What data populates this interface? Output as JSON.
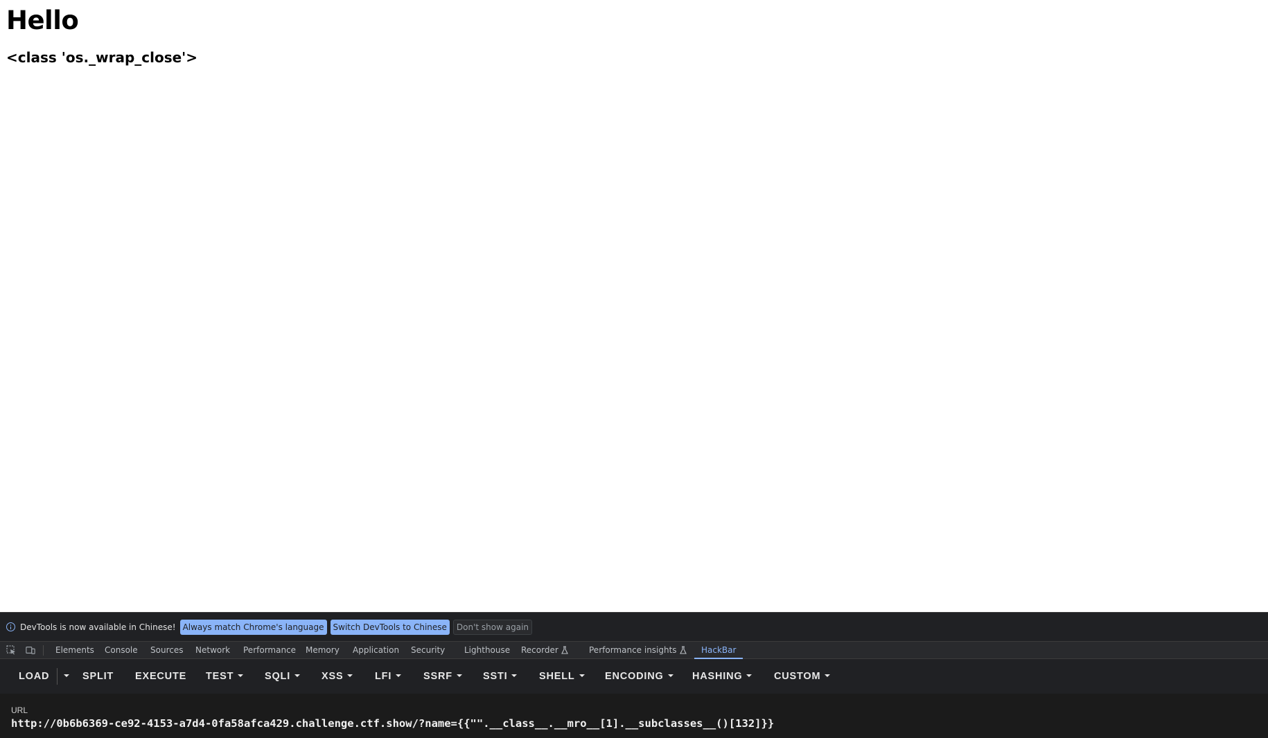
{
  "page": {
    "heading": "Hello",
    "output": "<class 'os._wrap_close'>"
  },
  "devtools": {
    "infobar": {
      "message": "DevTools is now available in Chinese!",
      "buttons": [
        "Always match Chrome's language",
        "Switch DevTools to Chinese",
        "Don't show again"
      ]
    },
    "tabs": [
      {
        "label": "Elements"
      },
      {
        "label": "Console"
      },
      {
        "label": "Sources"
      },
      {
        "label": "Network"
      },
      {
        "label": "Performance"
      },
      {
        "label": "Memory"
      },
      {
        "label": "Application"
      },
      {
        "label": "Security"
      },
      {
        "label": "Lighthouse"
      },
      {
        "label": "Recorder",
        "experimental": true
      },
      {
        "label": "Performance insights",
        "experimental": true
      },
      {
        "label": "HackBar",
        "active": true
      }
    ],
    "icons": [
      "inspect-element-icon",
      "device-toolbar-icon",
      "info-icon",
      "flask-icon"
    ],
    "accent_color": "#8ab4f8"
  },
  "hackbar": {
    "buttons": [
      {
        "label": "LOAD"
      },
      {
        "label": "SPLIT"
      },
      {
        "label": "EXECUTE"
      },
      {
        "label": "TEST"
      },
      {
        "label": "SQLI"
      },
      {
        "label": "XSS"
      },
      {
        "label": "LFI"
      },
      {
        "label": "SSRF"
      },
      {
        "label": "SSTI"
      },
      {
        "label": "SHELL"
      },
      {
        "label": "ENCODING"
      },
      {
        "label": "HASHING"
      },
      {
        "label": "CUSTOM"
      }
    ],
    "url_label": "URL",
    "url_value": "http://0b6b6369-ce92-4153-a7d4-0fa58afca429.challenge.ctf.show/?name={{\"\".__class__.__mro__[1].__subclasses__()[132]}}"
  }
}
